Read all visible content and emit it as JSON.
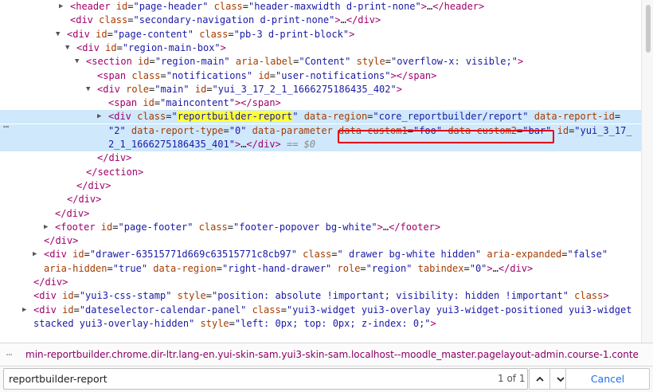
{
  "tree": [
    {
      "indent": 88,
      "twisty": "closed",
      "tokens": [
        {
          "c": "tag",
          "t": "<header"
        },
        {
          "c": "attr",
          "t": " id"
        },
        {
          "c": "plain",
          "t": "="
        },
        {
          "c": "val",
          "t": "\"page-header\""
        },
        {
          "c": "attr",
          "t": " class"
        },
        {
          "c": "plain",
          "t": "="
        },
        {
          "c": "val",
          "t": "\"header-maxwidth d-print-none\""
        },
        {
          "c": "tag",
          "t": ">"
        },
        {
          "c": "plain",
          "t": "…"
        },
        {
          "c": "tag",
          "t": "</header>"
        }
      ]
    },
    {
      "indent": 88,
      "twisty": "none",
      "tokens": [
        {
          "c": "tag",
          "t": "<div"
        },
        {
          "c": "attr",
          "t": " class"
        },
        {
          "c": "plain",
          "t": "="
        },
        {
          "c": "val",
          "t": "\"secondary-navigation d-print-none\""
        },
        {
          "c": "tag",
          "t": ">"
        },
        {
          "c": "plain",
          "t": "…"
        },
        {
          "c": "tag",
          "t": "</div>"
        }
      ]
    },
    {
      "indent": 84,
      "twisty": "open",
      "tokens": [
        {
          "c": "tag",
          "t": "<div"
        },
        {
          "c": "attr",
          "t": " id"
        },
        {
          "c": "plain",
          "t": "="
        },
        {
          "c": "val",
          "t": "\"page-content\""
        },
        {
          "c": "attr",
          "t": " class"
        },
        {
          "c": "plain",
          "t": "="
        },
        {
          "c": "val",
          "t": "\"pb-3 d-print-block\""
        },
        {
          "c": "tag",
          "t": ">"
        }
      ]
    },
    {
      "indent": 96,
      "twisty": "open",
      "tokens": [
        {
          "c": "tag",
          "t": "<div"
        },
        {
          "c": "attr",
          "t": " id"
        },
        {
          "c": "plain",
          "t": "="
        },
        {
          "c": "val",
          "t": "\"region-main-box\""
        },
        {
          "c": "tag",
          "t": ">"
        }
      ]
    },
    {
      "indent": 108,
      "twisty": "open",
      "tokens": [
        {
          "c": "tag",
          "t": "<section"
        },
        {
          "c": "attr",
          "t": " id"
        },
        {
          "c": "plain",
          "t": "="
        },
        {
          "c": "val",
          "t": "\"region-main\""
        },
        {
          "c": "attr",
          "t": " aria-label"
        },
        {
          "c": "plain",
          "t": "="
        },
        {
          "c": "val",
          "t": "\"Content\""
        },
        {
          "c": "attr",
          "t": " style"
        },
        {
          "c": "plain",
          "t": "="
        },
        {
          "c": "val",
          "t": "\"overflow-x: visible;\""
        },
        {
          "c": "tag",
          "t": ">"
        }
      ]
    },
    {
      "indent": 122,
      "twisty": "none",
      "tokens": [
        {
          "c": "tag",
          "t": "<span"
        },
        {
          "c": "attr",
          "t": " class"
        },
        {
          "c": "plain",
          "t": "="
        },
        {
          "c": "val",
          "t": "\"notifications\""
        },
        {
          "c": "attr",
          "t": " id"
        },
        {
          "c": "plain",
          "t": "="
        },
        {
          "c": "val",
          "t": "\"user-notifications\""
        },
        {
          "c": "tag",
          "t": "></span>"
        }
      ]
    },
    {
      "indent": 122,
      "twisty": "open",
      "tokens": [
        {
          "c": "tag",
          "t": "<div"
        },
        {
          "c": "attr",
          "t": " role"
        },
        {
          "c": "plain",
          "t": "="
        },
        {
          "c": "val",
          "t": "\"main\""
        },
        {
          "c": "attr",
          "t": " id"
        },
        {
          "c": "plain",
          "t": "="
        },
        {
          "c": "val",
          "t": "\"yui_3_17_2_1_1666275186435_402\""
        },
        {
          "c": "tag",
          "t": ">"
        }
      ]
    },
    {
      "indent": 136,
      "twisty": "none",
      "tokens": [
        {
          "c": "tag",
          "t": "<span"
        },
        {
          "c": "attr",
          "t": " id"
        },
        {
          "c": "plain",
          "t": "="
        },
        {
          "c": "val",
          "t": "\"maincontent\""
        },
        {
          "c": "tag",
          "t": "></span>"
        }
      ]
    },
    {
      "indent": 136,
      "twisty": "closed",
      "selected": true,
      "tokens": [
        {
          "c": "tag",
          "t": "<div"
        },
        {
          "c": "attr",
          "t": " class"
        },
        {
          "c": "plain",
          "t": "="
        },
        {
          "c": "val",
          "t": "\""
        },
        {
          "c": "val hl",
          "t": "reportbuilder-report"
        },
        {
          "c": "val",
          "t": "\""
        },
        {
          "c": "attr",
          "t": " data-region"
        },
        {
          "c": "plain",
          "t": "="
        },
        {
          "c": "val",
          "t": "\"core_reportbuilder/report\""
        },
        {
          "c": "attr",
          "t": " data-report-id"
        },
        {
          "c": "plain",
          "t": "="
        }
      ]
    },
    {
      "indent": 136,
      "twisty": "none",
      "selected": true,
      "tokens": [
        {
          "c": "val",
          "t": "\"2\""
        },
        {
          "c": "attr",
          "t": " data-report-type"
        },
        {
          "c": "plain",
          "t": "="
        },
        {
          "c": "val",
          "t": "\"0\""
        },
        {
          "c": "attr",
          "t": " data-parameter "
        },
        {
          "c": "attr",
          "t": "data-custom1"
        },
        {
          "c": "plain",
          "t": "="
        },
        {
          "c": "val",
          "t": "\"foo\""
        },
        {
          "c": "attr",
          "t": " data-custom2"
        },
        {
          "c": "plain",
          "t": "="
        },
        {
          "c": "val",
          "t": "\"bar\""
        },
        {
          "c": "attr",
          "t": " id"
        },
        {
          "c": "plain",
          "t": "="
        },
        {
          "c": "val",
          "t": "\"yui_3_17_"
        }
      ]
    },
    {
      "indent": 136,
      "twisty": "none",
      "selected": true,
      "tokens": [
        {
          "c": "val",
          "t": "2_1_1666275186435_401\""
        },
        {
          "c": "tag",
          "t": ">"
        },
        {
          "c": "plain",
          "t": "…"
        },
        {
          "c": "tag",
          "t": "</div>"
        },
        {
          "c": "eq",
          "t": " == $0"
        }
      ]
    },
    {
      "indent": 122,
      "twisty": "none",
      "tokens": [
        {
          "c": "tag",
          "t": "</div>"
        }
      ]
    },
    {
      "indent": 108,
      "twisty": "none",
      "tokens": [
        {
          "c": "tag",
          "t": "</section>"
        }
      ]
    },
    {
      "indent": 96,
      "twisty": "none",
      "tokens": [
        {
          "c": "tag",
          "t": "</div>"
        }
      ]
    },
    {
      "indent": 84,
      "twisty": "none",
      "tokens": [
        {
          "c": "tag",
          "t": "</div>"
        }
      ]
    },
    {
      "indent": 69,
      "twisty": "none",
      "tokens": [
        {
          "c": "tag",
          "t": "</div>"
        }
      ]
    },
    {
      "indent": 69,
      "twisty": "closed",
      "tokens": [
        {
          "c": "tag",
          "t": "<footer"
        },
        {
          "c": "attr",
          "t": " id"
        },
        {
          "c": "plain",
          "t": "="
        },
        {
          "c": "val",
          "t": "\"page-footer\""
        },
        {
          "c": "attr",
          "t": " class"
        },
        {
          "c": "plain",
          "t": "="
        },
        {
          "c": "val",
          "t": "\"footer-popover bg-white\""
        },
        {
          "c": "tag",
          "t": ">"
        },
        {
          "c": "plain",
          "t": "…"
        },
        {
          "c": "tag",
          "t": "</footer>"
        }
      ]
    },
    {
      "indent": 55,
      "twisty": "none",
      "tokens": [
        {
          "c": "tag",
          "t": "</div>"
        }
      ]
    },
    {
      "indent": 55,
      "twisty": "closed",
      "tokens": [
        {
          "c": "tag",
          "t": "<div"
        },
        {
          "c": "attr",
          "t": " id"
        },
        {
          "c": "plain",
          "t": "="
        },
        {
          "c": "val",
          "t": "\"drawer-63515771d669c63515771c8cb97\""
        },
        {
          "c": "attr",
          "t": " class"
        },
        {
          "c": "plain",
          "t": "="
        },
        {
          "c": "val",
          "t": "\" drawer bg-white hidden\""
        },
        {
          "c": "attr",
          "t": " aria-expanded"
        },
        {
          "c": "plain",
          "t": "="
        },
        {
          "c": "val",
          "t": "\"false\""
        }
      ]
    },
    {
      "indent": 55,
      "twisty": "none",
      "tokens": [
        {
          "c": "attr",
          "t": "aria-hidden"
        },
        {
          "c": "plain",
          "t": "="
        },
        {
          "c": "val",
          "t": "\"true\""
        },
        {
          "c": "attr",
          "t": " data-region"
        },
        {
          "c": "plain",
          "t": "="
        },
        {
          "c": "val",
          "t": "\"right-hand-drawer\""
        },
        {
          "c": "attr",
          "t": " role"
        },
        {
          "c": "plain",
          "t": "="
        },
        {
          "c": "val",
          "t": "\"region\""
        },
        {
          "c": "attr",
          "t": " tabindex"
        },
        {
          "c": "plain",
          "t": "="
        },
        {
          "c": "val",
          "t": "\"0\""
        },
        {
          "c": "tag",
          "t": ">"
        },
        {
          "c": "plain",
          "t": "…"
        },
        {
          "c": "tag",
          "t": "</div>"
        }
      ]
    },
    {
      "indent": 42,
      "twisty": "none",
      "tokens": [
        {
          "c": "tag",
          "t": "</div>"
        }
      ]
    },
    {
      "indent": 42,
      "twisty": "none",
      "tokens": [
        {
          "c": "tag",
          "t": "<div"
        },
        {
          "c": "attr",
          "t": " id"
        },
        {
          "c": "plain",
          "t": "="
        },
        {
          "c": "val",
          "t": "\"yui3-css-stamp\""
        },
        {
          "c": "attr",
          "t": " style"
        },
        {
          "c": "plain",
          "t": "="
        },
        {
          "c": "val",
          "t": "\"position: absolute !important; visibility: hidden !important\""
        },
        {
          "c": "attr",
          "t": " class"
        },
        {
          "c": "tag",
          "t": ">"
        }
      ]
    },
    {
      "indent": 42,
      "twisty": "closed",
      "tokens": [
        {
          "c": "tag",
          "t": "<div"
        },
        {
          "c": "attr",
          "t": " id"
        },
        {
          "c": "plain",
          "t": "="
        },
        {
          "c": "val",
          "t": "\"dateselector-calendar-panel\""
        },
        {
          "c": "attr",
          "t": " class"
        },
        {
          "c": "plain",
          "t": "="
        },
        {
          "c": "val",
          "t": "\"yui3-widget yui3-overlay yui3-widget-positioned yui3-widget"
        }
      ]
    },
    {
      "indent": 42,
      "twisty": "none",
      "tokens": [
        {
          "c": "val",
          "t": "stacked yui3-overlay-hidden\""
        },
        {
          "c": "attr",
          "t": " style"
        },
        {
          "c": "plain",
          "t": "="
        },
        {
          "c": "val",
          "t": "\"left: 0px; top: 0px; z-index: 0;\""
        },
        {
          "c": "tag",
          "t": ">"
        }
      ]
    }
  ],
  "selected_marker": "…",
  "breadcrumb": {
    "text": "min-reportbuilder.chrome.dir-ltr.lang-en.yui-skin-sam.yui3-skin-sam.localhost--moodle_master.pagelayout-admin.course-1.conte"
  },
  "search": {
    "value": "reportbuilder-report",
    "count": "1 of 1",
    "cancel_label": "Cancel"
  },
  "colors": {
    "tag": "#a0006a",
    "attribute": "#a53c00",
    "value": "#1a1aa6",
    "selection": "#cfe8fc",
    "match_highlight": "#ffff38",
    "annotation_box": "#e0001b",
    "cancel_text": "#1f6feb"
  }
}
